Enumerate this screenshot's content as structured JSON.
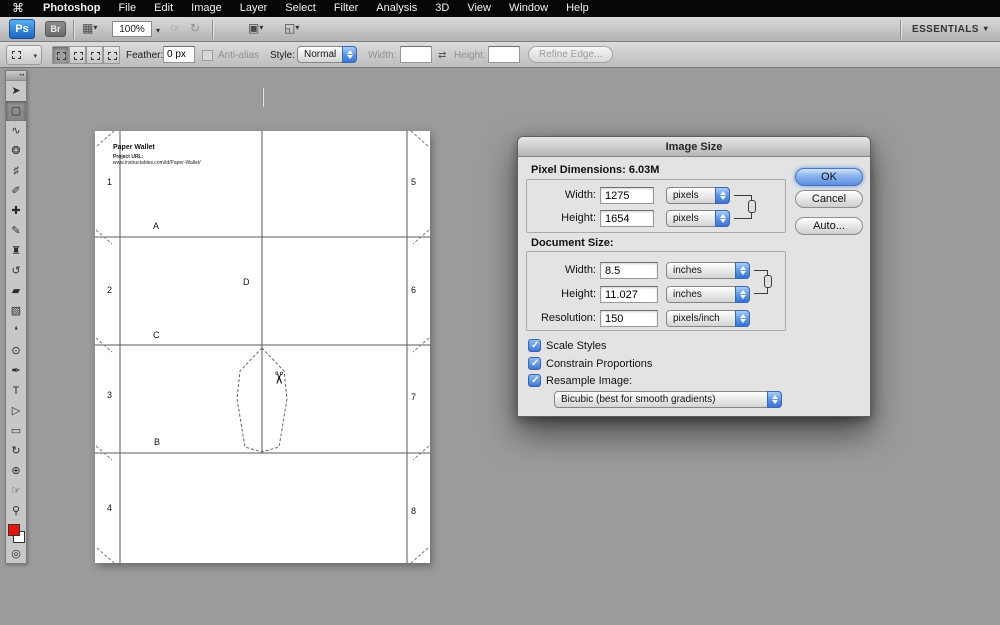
{
  "menu_bar": {
    "apple_icon": "⌘",
    "app_name": "Photoshop",
    "items": [
      "File",
      "Edit",
      "Image",
      "Layer",
      "Select",
      "Filter",
      "Analysis",
      "3D",
      "View",
      "Window",
      "Help"
    ]
  },
  "app_bar": {
    "ps_badge": "Ps",
    "br_badge": "Br",
    "zoom_value": "100%",
    "workspace_label": "ESSENTIALS"
  },
  "options_bar": {
    "feather_label": "Feather:",
    "feather_value": "0 px",
    "anti_alias_label": "Anti-alias",
    "style_label": "Style:",
    "style_value": "Normal",
    "width_label": "Width:",
    "width_value": "",
    "height_label": "Height:",
    "height_value": "",
    "refine_edge_label": "Refine Edge..."
  },
  "icons": {
    "caret_down": "▾",
    "grid": "▦",
    "hand": "☞",
    "rotate": "↻",
    "arrange": "▣",
    "screen_mode": "◱",
    "swap": "⇄",
    "quick_mask": "◎"
  },
  "toolbar": {
    "foreground_color": "#e8150d",
    "background_color": "#ffffff",
    "selected_tool": "rectangular-marquee",
    "tools": [
      {
        "name": "move",
        "glyph": "➤"
      },
      {
        "name": "rectangular-marquee",
        "glyph": "▢"
      },
      {
        "name": "lasso",
        "glyph": "∿"
      },
      {
        "name": "quick-selection",
        "glyph": "❂"
      },
      {
        "name": "crop",
        "glyph": "♯"
      },
      {
        "name": "eyedropper",
        "glyph": "✐"
      },
      {
        "name": "spot-healing-brush",
        "glyph": "✚"
      },
      {
        "name": "brush",
        "glyph": "✎"
      },
      {
        "name": "clone-stamp",
        "glyph": "♜"
      },
      {
        "name": "history-brush",
        "glyph": "↺"
      },
      {
        "name": "eraser",
        "glyph": "▰"
      },
      {
        "name": "gradient",
        "glyph": "▧"
      },
      {
        "name": "blur",
        "glyph": "❛"
      },
      {
        "name": "dodge",
        "glyph": "⊙"
      },
      {
        "name": "pen",
        "glyph": "✒"
      },
      {
        "name": "type",
        "glyph": "T"
      },
      {
        "name": "path-selection",
        "glyph": "▷"
      },
      {
        "name": "rectangle",
        "glyph": "▭"
      },
      {
        "name": "3d-rotate",
        "glyph": "↻"
      },
      {
        "name": "3d-orbit",
        "glyph": "⊕"
      },
      {
        "name": "hand",
        "glyph": "☞"
      },
      {
        "name": "zoom",
        "glyph": "⚲"
      }
    ]
  },
  "document_page": {
    "title": "Paper Wallet",
    "url_label": "Project URL:",
    "url": "www.instructables.com/id/Paper-Wallet/",
    "left_numbers": [
      "1",
      "2",
      "3",
      "4"
    ],
    "right_numbers": [
      "5",
      "6",
      "7",
      "8"
    ],
    "letter_a": "A",
    "letter_b": "B",
    "letter_c": "C",
    "letter_d": "D",
    "scissors_icon": "✂"
  },
  "dialog": {
    "title": "Image Size",
    "pixel_dimensions_label": "Pixel Dimensions:",
    "pixel_dimensions_value": "6.03M",
    "pixel_width_label": "Width:",
    "pixel_width_value": "1275",
    "pixel_width_unit": "pixels",
    "pixel_height_label": "Height:",
    "pixel_height_value": "1654",
    "pixel_height_unit": "pixels",
    "document_size_label": "Document Size:",
    "doc_width_label": "Width:",
    "doc_width_value": "8.5",
    "doc_width_unit": "inches",
    "doc_height_label": "Height:",
    "doc_height_value": "11.027",
    "doc_height_unit": "inches",
    "resolution_label": "Resolution:",
    "resolution_value": "150",
    "resolution_unit": "pixels/inch",
    "scale_styles_label": "Scale Styles",
    "constrain_proportions_label": "Constrain Proportions",
    "resample_label": "Resample Image:",
    "resample_method": "Bicubic (best for smooth gradients)",
    "ok_label": "OK",
    "cancel_label": "Cancel",
    "auto_label": "Auto..."
  }
}
